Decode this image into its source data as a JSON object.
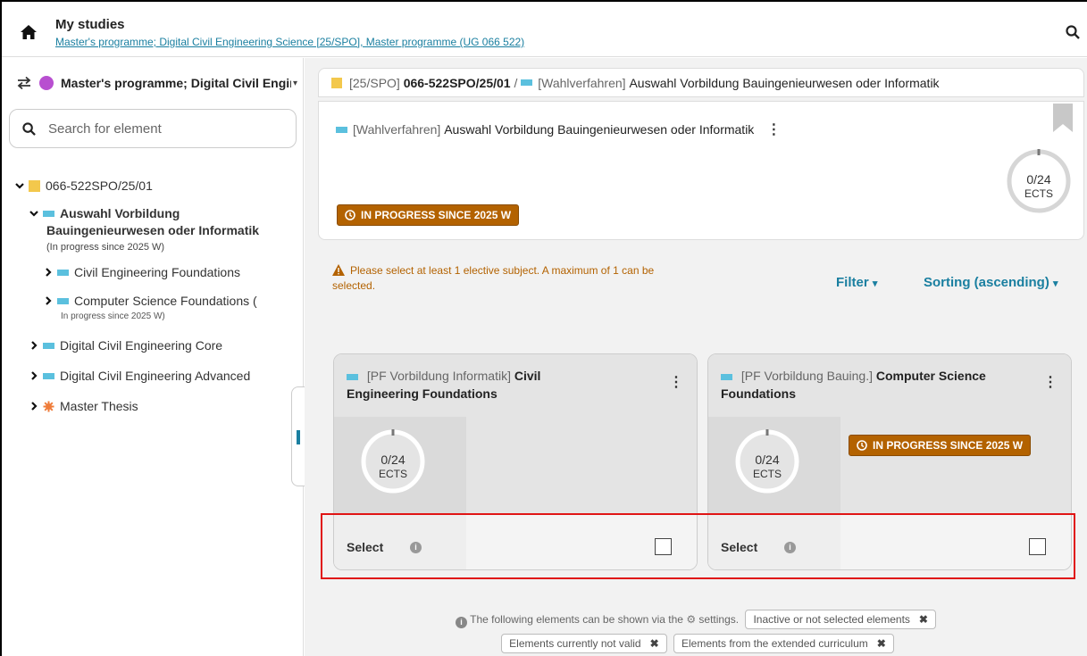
{
  "header": {
    "title": "My studies",
    "subtitle": "Master's programme; Digital Civil Engineering Science [25/SPO], Master programme (UG 066 522)"
  },
  "sidebar": {
    "programme_label": "Master's programme; Digital Civil Engineering Science",
    "search_placeholder": "Search for element",
    "tree": {
      "root": "066-522SPO/25/01",
      "selected_line1": "Auswahl Vorbildung",
      "selected_line2": "Bauingenieurwesen oder Informatik",
      "selected_status": "(In progress since 2025 W)",
      "child1": "Civil Engineering Foundations",
      "child2": "Computer Science Foundations (",
      "child2_status": "In progress since 2025 W)",
      "item3": "Digital Civil Engineering Core",
      "item4": "Digital Civil Engineering Advanced",
      "item5": "Master Thesis"
    }
  },
  "breadcrumb": {
    "part1_tag": "[25/SPO]",
    "part1_code": "066-522SPO/25/01",
    "separator": "/",
    "part2_tag": "[Wahlverfahren]",
    "part2_name": "Auswahl Vorbildung Bauingenieurwesen oder Informatik"
  },
  "selection_card": {
    "tag": "[Wahlverfahren]",
    "name": "Auswahl Vorbildung Bauingenieurwesen oder Informatik",
    "ects_value": "0/24",
    "ects_unit": "ECTS",
    "status_badge": "IN PROGRESS SINCE 2025 W"
  },
  "warning": "Please select at least 1 elective subject. A maximum of 1 can be selected.",
  "toolbar": {
    "filter_label": "Filter",
    "sort_label": "Sorting (ascending)"
  },
  "elective_cards": [
    {
      "tag": "[PF Vorbildung Informatik]",
      "name_line1": "Civil",
      "name_line2": "Engineering Foundations",
      "ects_value": "0/24",
      "ects_unit": "ECTS",
      "select_label": "Select"
    },
    {
      "tag": "[PF Vorbildung Bauing.]",
      "name_line1": "Computer Science",
      "name_line2": "Foundations",
      "ects_value": "0/24",
      "ects_unit": "ECTS",
      "status_badge": "IN PROGRESS SINCE 2025 W",
      "select_label": "Select"
    }
  ],
  "hint": {
    "text_before": "The following elements can be shown via the",
    "text_after": "settings.",
    "chip1": "Inactive or not selected elements",
    "chip2": "Elements currently not valid",
    "chip3": "Elements from the extended curriculum"
  },
  "colors": {
    "accent": "#1a7fa0",
    "badge": "#b36200",
    "highlight": "#e01515"
  }
}
